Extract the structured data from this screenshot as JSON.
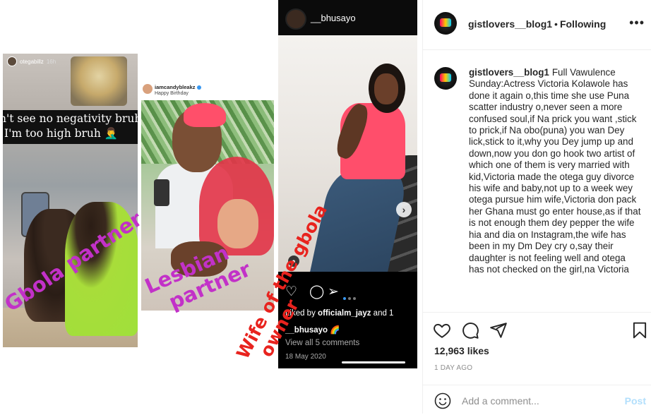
{
  "collage": {
    "story1": {
      "username": "otegabillz",
      "time": "16h",
      "caption_line1": "n't see no negativity bruh",
      "caption_line2": "I'm too high bruh 🤦‍♂️"
    },
    "story2": {
      "username": "iamcandybleakz",
      "subtitle": "Happy Birthday"
    },
    "story3": {
      "username": "__bhusayo",
      "liked_prefix": "Liked by",
      "liked_user": "officialm_jayz",
      "liked_suffix": "and 1",
      "caption_user": "__bhusayo 🌈",
      "comments": "View all 5 comments",
      "date": "18 May 2020",
      "next_glyph": "›",
      "tag_glyph": "●"
    },
    "annotations": {
      "gbola": "Gbola partner",
      "lesbian_line1": "Lesbian",
      "lesbian_line2": "partner",
      "wife_line1": "Wife of the gbola",
      "wife_line2": "owner"
    }
  },
  "post": {
    "header": {
      "username": "gistlovers__blog1",
      "separator": "•",
      "following": "Following",
      "more": "•••"
    },
    "caption": {
      "username": "gistlovers__blog1",
      "text": "Full Vawulence Sunday:Actress Victoria Kolawole has done it again o,this time she use Puna scatter industry o,never seen a more confused soul,if Na prick you want ,stick to prick,if Na obo(puna) you wan Dey lick,stick to it,why you Dey jump up and down,now you don go hook two artist of which one of them is very married with kid,Victoria made the otega guy divorce his wife and baby,not up to a week wey otega pursue him wife,Victoria don pack her Ghana must go enter house,as if that is not enough them dey pepper the wife hia and dia on Instagram,the wife has been in my Dm Dey cry o,say their daughter is not feeling well and otega has not checked on the girl,na Victoria"
    },
    "likes": "12,963 likes",
    "time_ago": "1 DAY AGO",
    "comment_placeholder": "Add a comment...",
    "post_label": "Post",
    "icons": [
      "heart-icon",
      "comment-icon",
      "share-icon",
      "bookmark-icon",
      "emoji-icon"
    ],
    "colors": {
      "link_disabled": "#b2dffc",
      "muted": "#8e8e8e",
      "text": "#262626",
      "annot_purple": "#c231c8",
      "annot_red": "#e8231e"
    }
  }
}
